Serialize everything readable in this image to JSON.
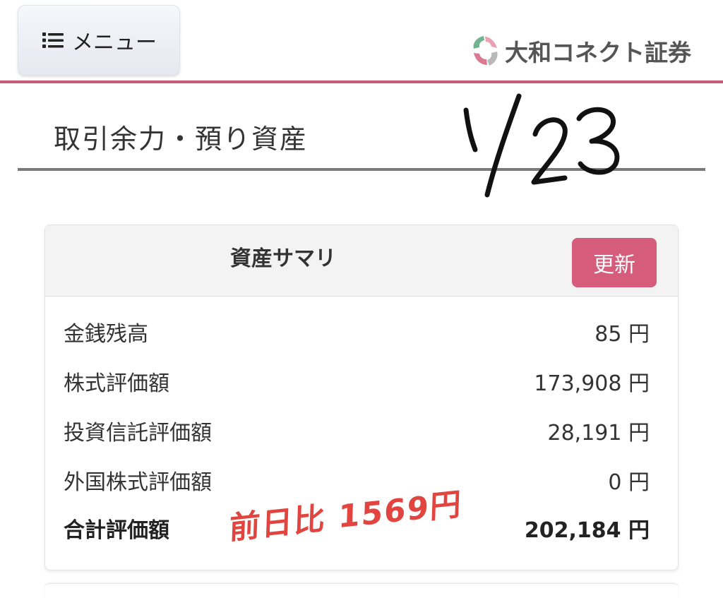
{
  "header": {
    "menu_label": "メニュー",
    "logo_text": "大和コネクト証券",
    "accent_color": "#c85a77"
  },
  "page": {
    "title": "取引余力・預り資産"
  },
  "handwriting": {
    "date": "1/23",
    "note": "前日比 1569円",
    "note_color": "#e2453f"
  },
  "summary": {
    "title": "資産サマリ",
    "refresh_label": "更新",
    "rows": [
      {
        "label": "金銭残高",
        "value": "85 円"
      },
      {
        "label": "株式評価額",
        "value": "173,908 円"
      },
      {
        "label": "投資信託評価額",
        "value": "28,191 円"
      },
      {
        "label": "外国株式評価額",
        "value": "0 円"
      },
      {
        "label": "合計評価額",
        "value": "202,184 円"
      }
    ]
  }
}
